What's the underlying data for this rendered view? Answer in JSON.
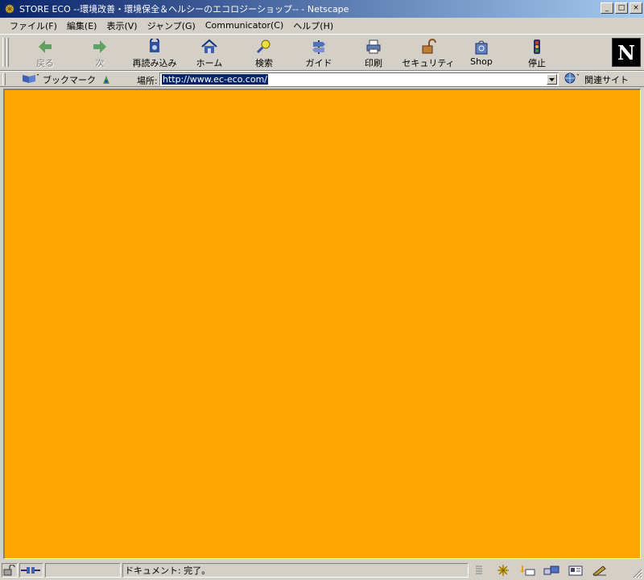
{
  "window": {
    "title": "STORE ECO --環境改善・環境保全＆ヘルシーのエコロジーショップ-- - Netscape",
    "minimize": "_",
    "maximize": "□",
    "close": "×"
  },
  "menu": [
    {
      "label": "ファイル(F)"
    },
    {
      "label": "編集(E)"
    },
    {
      "label": "表示(V)"
    },
    {
      "label": "ジャンプ(G)"
    },
    {
      "label": "Communicator(C)"
    },
    {
      "label": "ヘルプ(H)"
    }
  ],
  "toolbar": {
    "back": "戻る",
    "forward": "次",
    "reload": "再読み込み",
    "home": "ホーム",
    "search": "検索",
    "guide": "ガイド",
    "print": "印刷",
    "security": "セキュリティ",
    "shop": "Shop",
    "stop": "停止",
    "logo": "N"
  },
  "location": {
    "bookmarks": "ブックマーク",
    "label": "場所:",
    "url": "http://www.ec-eco.com/",
    "related": "関連サイト"
  },
  "content": {
    "background": "#ffa500"
  },
  "status": {
    "text": "ドキュメント: 完了。"
  }
}
